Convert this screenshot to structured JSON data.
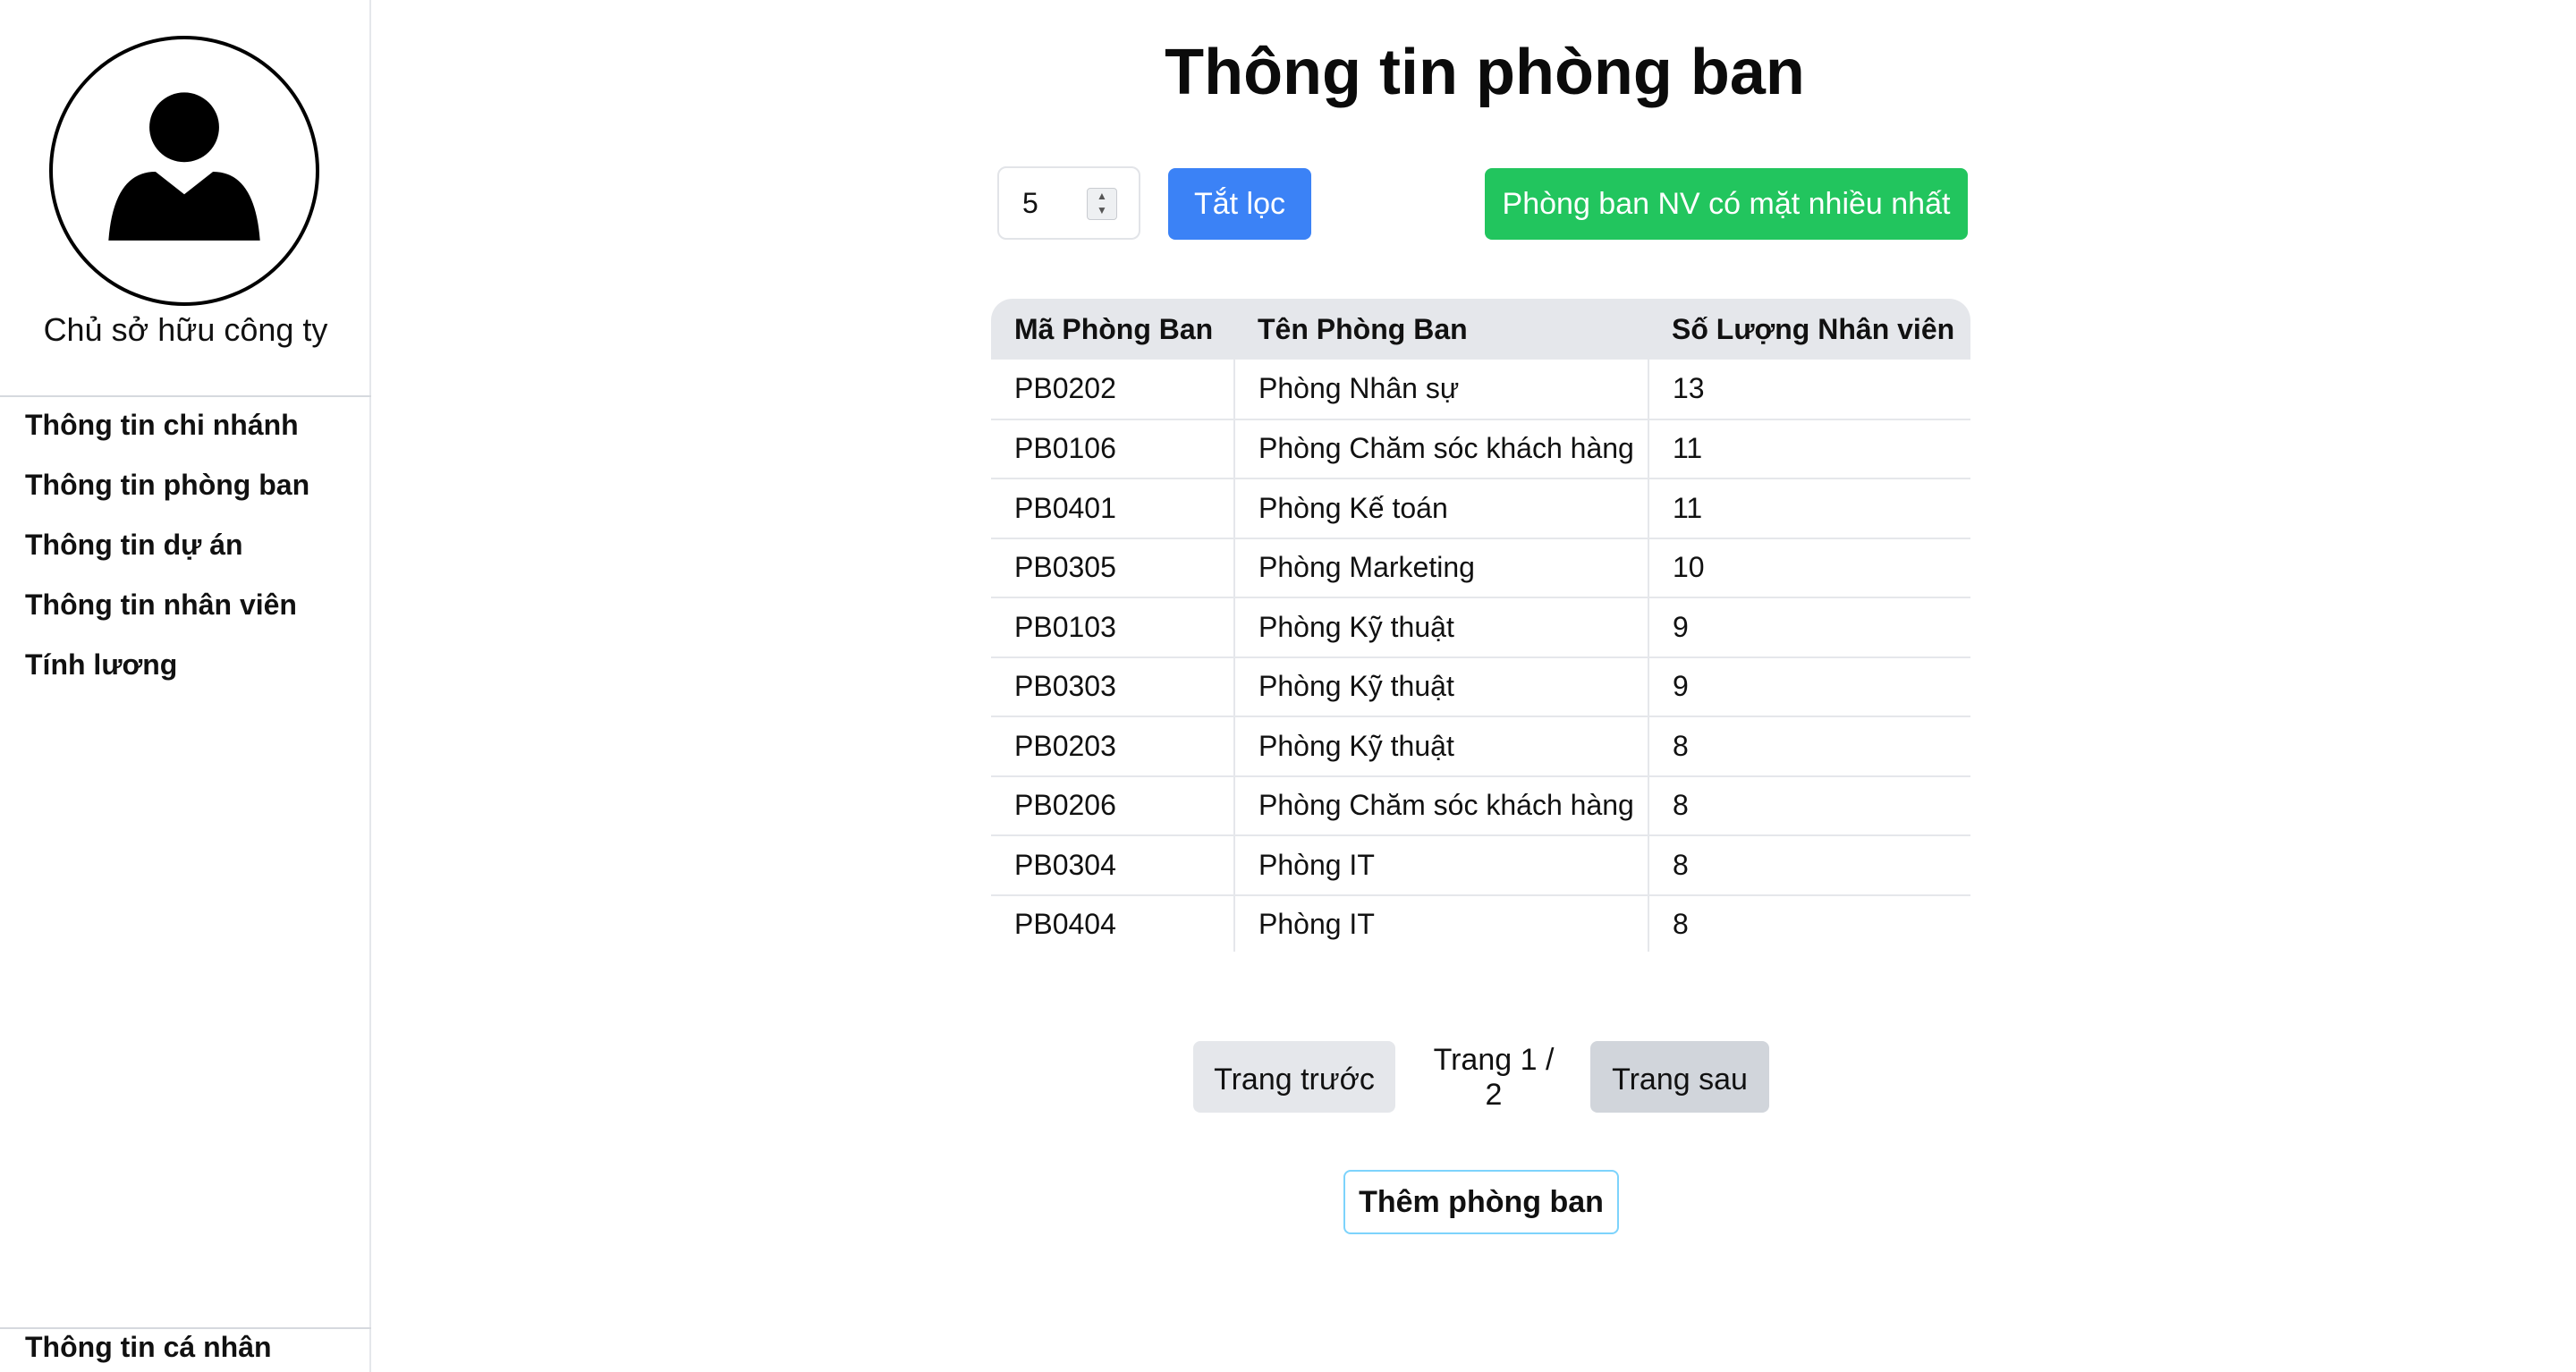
{
  "sidebar": {
    "role": "Chủ sở hữu công ty",
    "nav": [
      {
        "label": "Thông tin chi nhánh"
      },
      {
        "label": "Thông tin phòng ban"
      },
      {
        "label": "Thông tin dự án"
      },
      {
        "label": "Thông tin nhân viên"
      },
      {
        "label": "Tính lương"
      }
    ],
    "bottom_link": "Thông tin cá nhân",
    "avatar_icon": "user-avatar-icon"
  },
  "main": {
    "title": "Thông tin phòng ban",
    "page_size_value": "5",
    "filter_off_label": "Tắt lọc",
    "most_present_label": "Phòng ban NV có mặt nhiều nhất",
    "table": {
      "headers": [
        "Mã Phòng Ban",
        "Tên Phòng Ban",
        "Số Lượng Nhân viên"
      ],
      "rows": [
        [
          "PB0202",
          "Phòng Nhân sự",
          "13"
        ],
        [
          "PB0106",
          "Phòng Chăm sóc khách hàng",
          "11"
        ],
        [
          "PB0401",
          "Phòng Kế toán",
          "11"
        ],
        [
          "PB0305",
          "Phòng Marketing",
          "10"
        ],
        [
          "PB0103",
          "Phòng Kỹ thuật",
          "9"
        ],
        [
          "PB0303",
          "Phòng Kỹ thuật",
          "9"
        ],
        [
          "PB0203",
          "Phòng Kỹ thuật",
          "8"
        ],
        [
          "PB0206",
          "Phòng Chăm sóc khách hàng",
          "8"
        ],
        [
          "PB0304",
          "Phòng IT",
          "8"
        ],
        [
          "PB0404",
          "Phòng IT",
          "8"
        ]
      ]
    },
    "pagination": {
      "prev_label": "Trang trước",
      "page_info": "Trang 1 / 2",
      "next_label": "Trang sau"
    },
    "add_label": "Thêm phòng ban"
  },
  "colors": {
    "blue_button": "#3b82f6",
    "green_button": "#22c55e",
    "header_bg": "#e5e7eb"
  }
}
